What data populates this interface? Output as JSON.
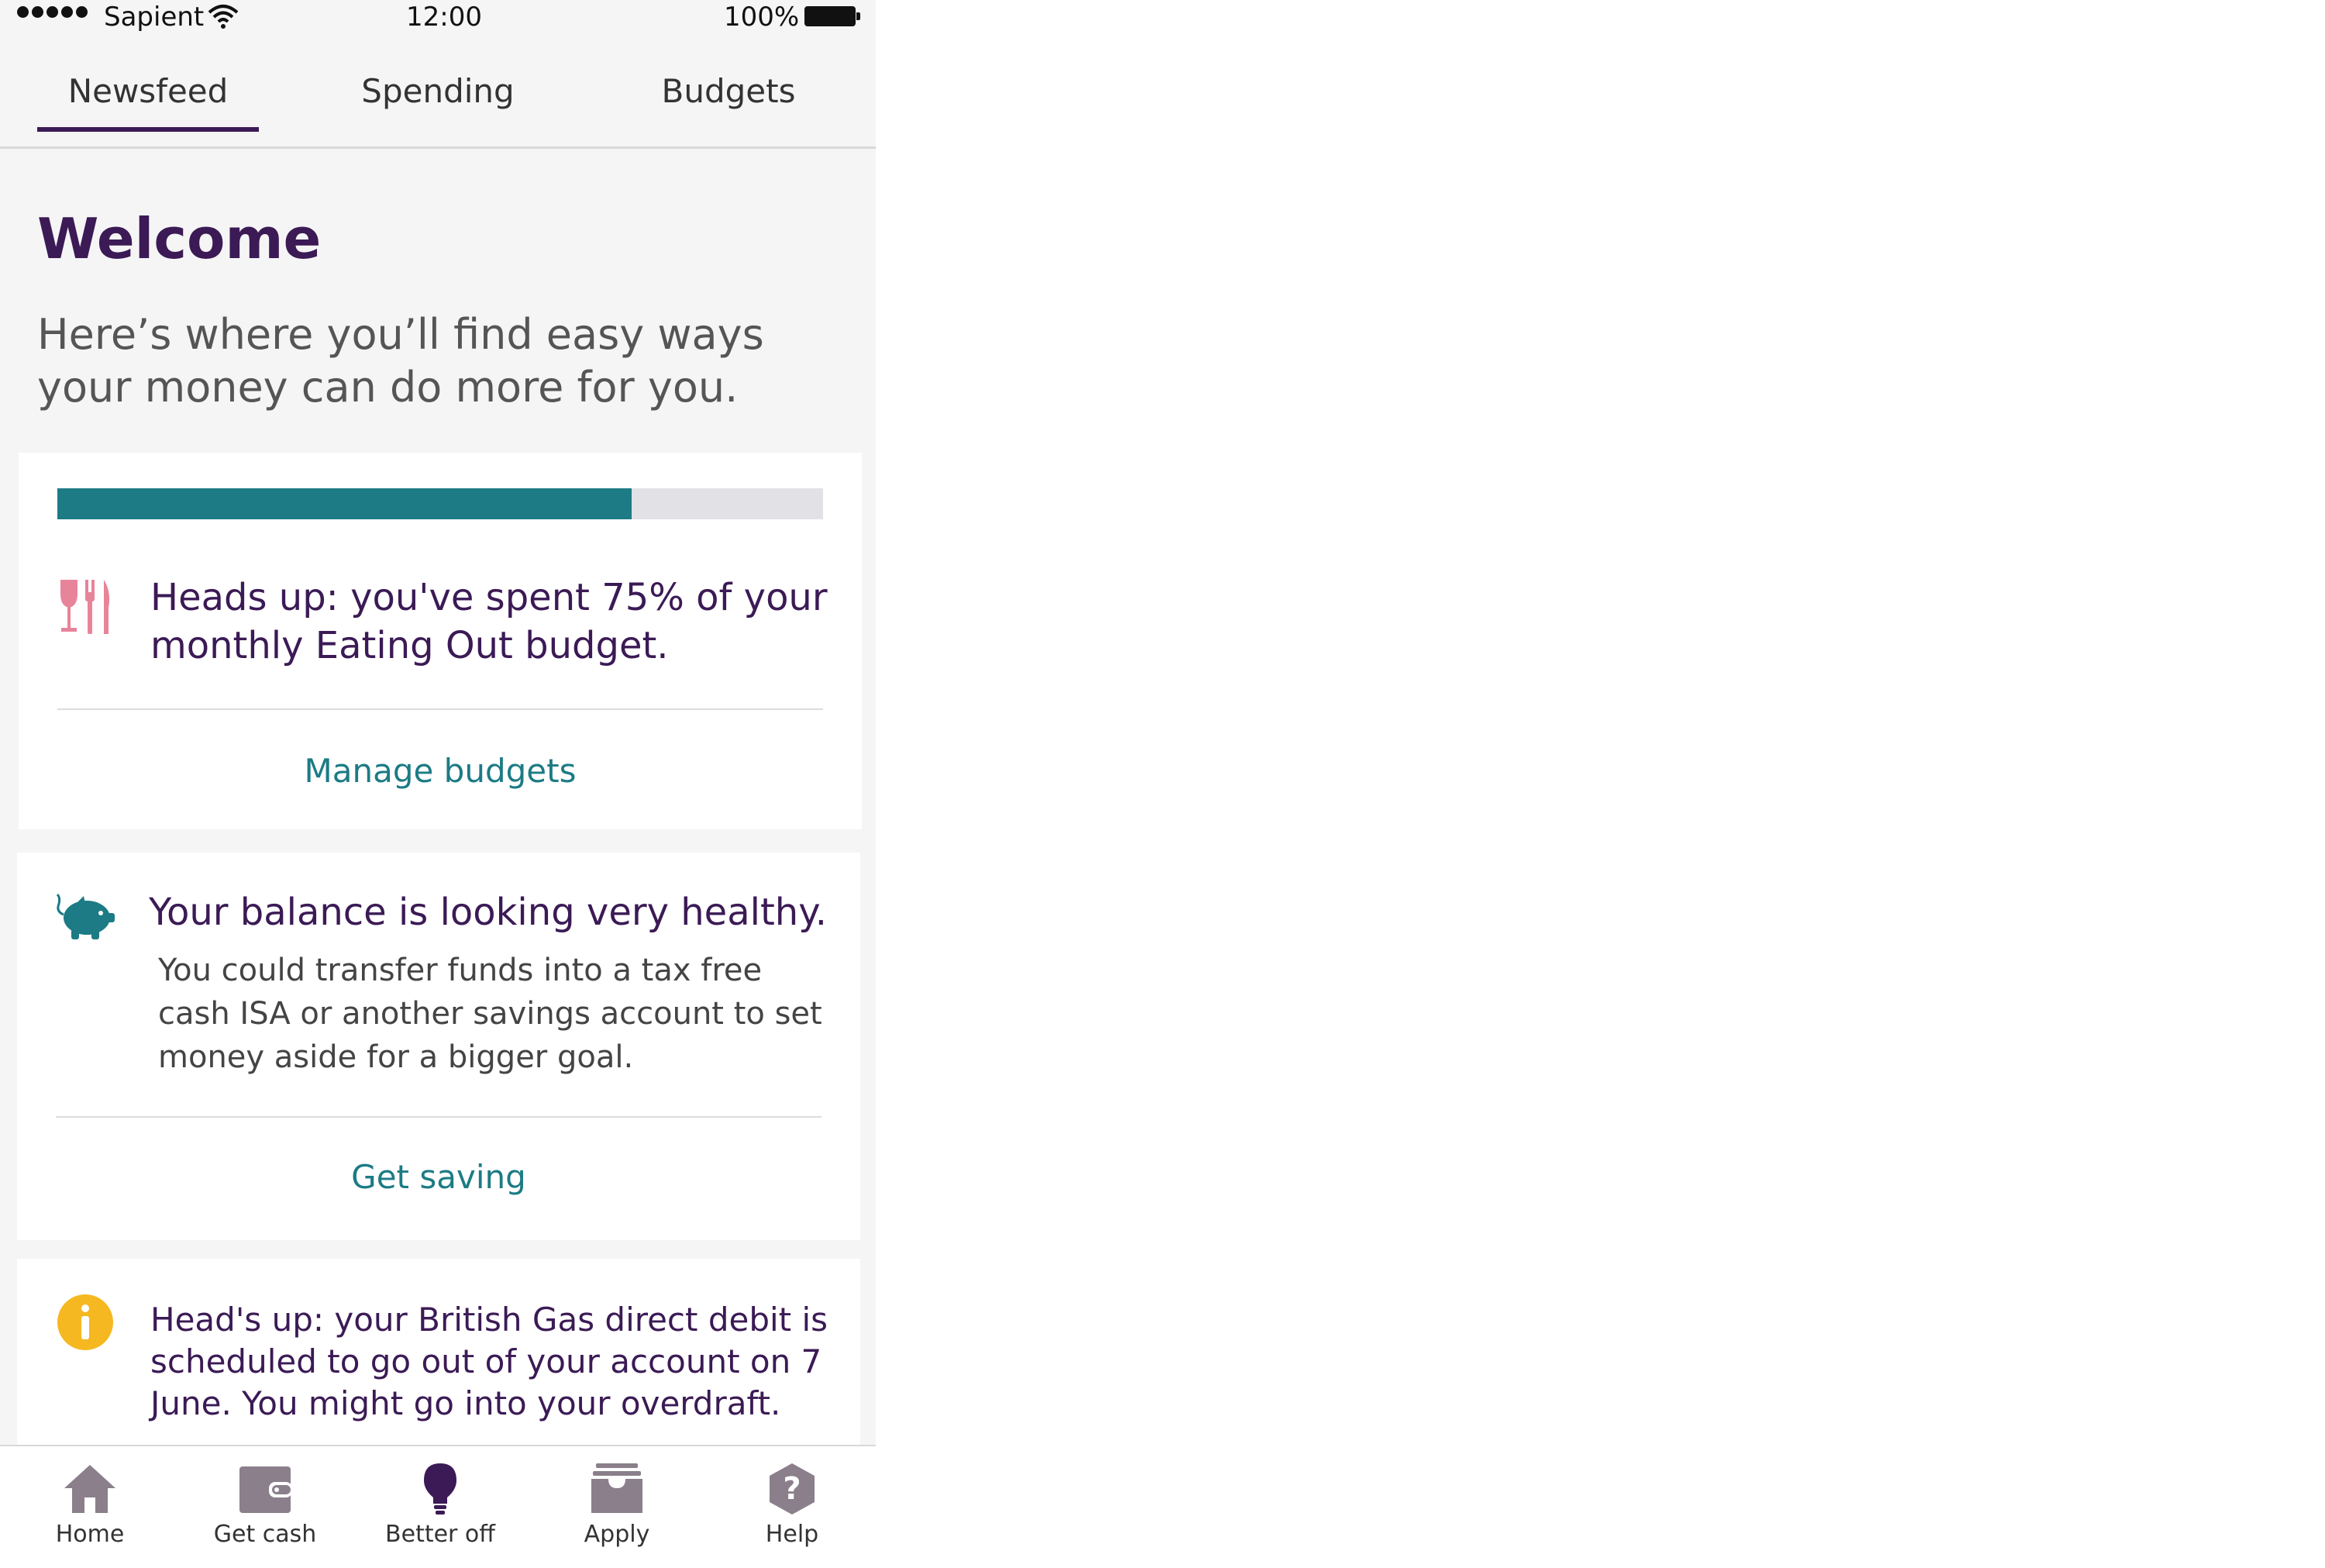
{
  "status_bar": {
    "carrier": "Sapient",
    "time": "12:00",
    "battery": "100%"
  },
  "tabs": [
    {
      "label": "Newsfeed",
      "active": true
    },
    {
      "label": "Spending",
      "active": false
    },
    {
      "label": "Budgets",
      "active": false
    }
  ],
  "welcome": {
    "title": "Welcome",
    "subtitle": "Here’s where you’ll find easy ways your money can do more for you."
  },
  "cards": [
    {
      "icon": "cutlery-icon",
      "progress_fraction": 0.75,
      "text": "Heads up: you've spent 75% of your monthly Eating Out budget.",
      "link": "Manage budgets"
    },
    {
      "icon": "piggy-bank-icon",
      "title": "Your balance is looking very healthy.",
      "body": "You could transfer funds into a tax free cash ISA or another savings account to set money aside for a bigger goal.",
      "link": "Get saving"
    },
    {
      "icon": "info-icon",
      "text": "Head's up: your British Gas direct debit is scheduled to go out of your account on 7 June. You might go into your overdraft."
    }
  ],
  "bottom_nav": [
    {
      "label": "Home",
      "icon": "home-icon"
    },
    {
      "label": "Get cash",
      "icon": "wallet-icon"
    },
    {
      "label": "Better off",
      "icon": "lightbulb-icon",
      "active": true
    },
    {
      "label": "Apply",
      "icon": "inbox-icon"
    },
    {
      "label": "Help",
      "icon": "help-icon"
    }
  ],
  "colors": {
    "brand_purple": "#3b1a55",
    "accent_teal": "#1c7b85",
    "progress_track": "#e1e1e6",
    "icon_pink": "#e8849a",
    "info_yellow": "#f6b820",
    "nav_grey": "#8a7f8a"
  }
}
